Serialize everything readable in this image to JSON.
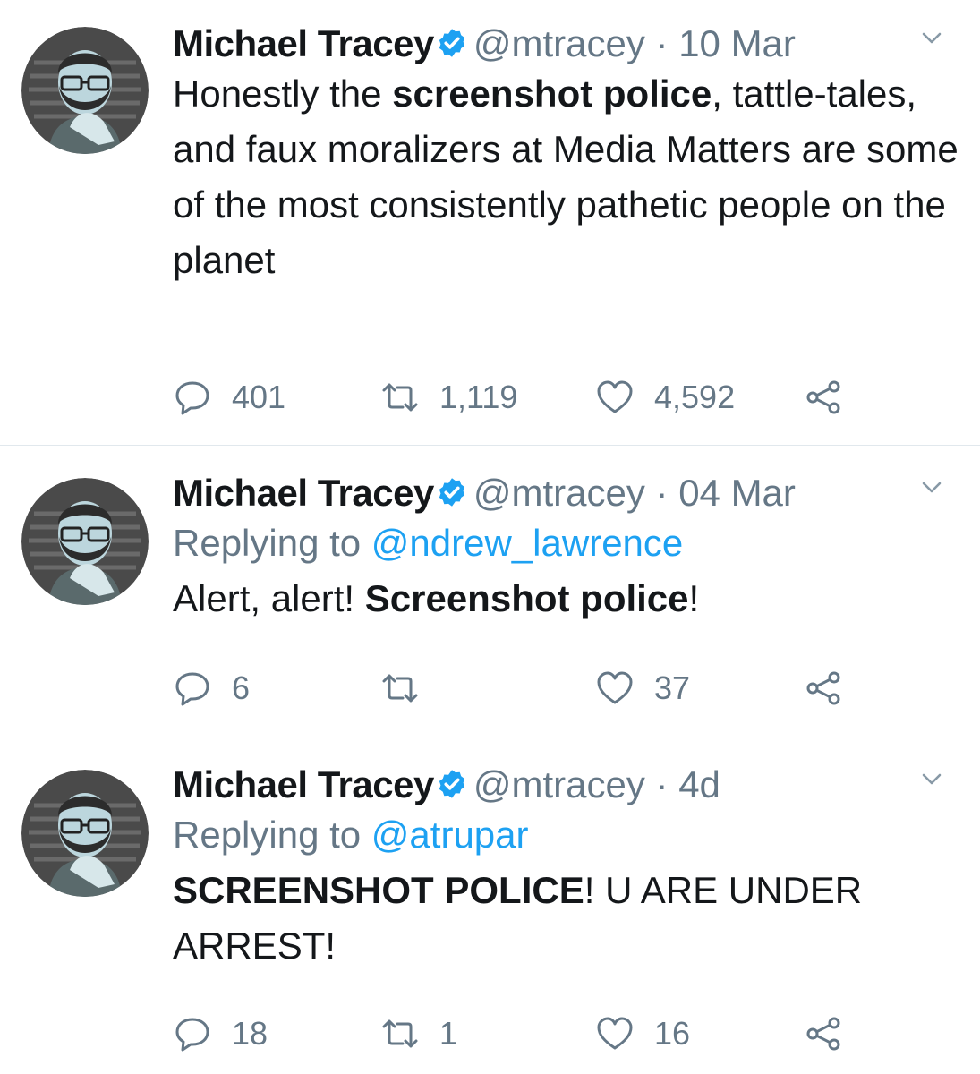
{
  "tweets": [
    {
      "name": "Michael Tracey",
      "handle": "@mtracey",
      "dot": "·",
      "time": "10 Mar",
      "reply_prefix": "",
      "reply_handle": "",
      "text_runs": [
        {
          "t": "Honestly the ",
          "b": false
        },
        {
          "t": "screenshot police",
          "b": true
        },
        {
          "t": ", tattle-tales, and faux moralizers at Media Matters are some of the most consistently pathetic people on the planet",
          "b": false
        }
      ],
      "replies": "401",
      "retweets": "1,119",
      "likes": "4,592"
    },
    {
      "name": "Michael Tracey",
      "handle": "@mtracey",
      "dot": "·",
      "time": "04 Mar",
      "reply_prefix": "Replying to ",
      "reply_handle": "@ndrew_lawrence",
      "text_runs": [
        {
          "t": "Alert, alert! ",
          "b": false
        },
        {
          "t": "Screenshot police",
          "b": true
        },
        {
          "t": "!",
          "b": false
        }
      ],
      "replies": "6",
      "retweets": "",
      "likes": "37"
    },
    {
      "name": "Michael Tracey",
      "handle": "@mtracey",
      "dot": "·",
      "time": "4d",
      "reply_prefix": "Replying to ",
      "reply_handle": "@atrupar",
      "text_runs": [
        {
          "t": "SCREENSHOT POLICE",
          "b": true
        },
        {
          "t": "! U ARE UNDER ARREST!",
          "b": false
        }
      ],
      "replies": "18",
      "retweets": "1",
      "likes": "16"
    }
  ],
  "icons": {
    "verified": "verified-badge-icon",
    "caret": "chevron-down-icon",
    "reply": "reply-icon",
    "retweet": "retweet-icon",
    "like": "heart-icon",
    "share": "share-icon"
  },
  "colors": {
    "name": "#14171a",
    "secondary": "#657786",
    "link": "#1da1f2",
    "verified": "#1da1f2",
    "divider": "#e1e8ed",
    "avatar_bg": "#bcd6dd",
    "avatar_ring": "#4a4a4a"
  }
}
